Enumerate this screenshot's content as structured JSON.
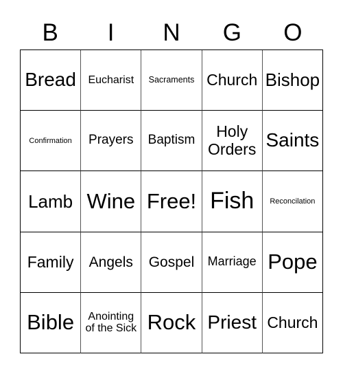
{
  "header": {
    "letters": [
      "B",
      "I",
      "N",
      "G",
      "O"
    ]
  },
  "cells": [
    [
      "Bread",
      "Eucharist",
      "Sacraments",
      "Church",
      "Bishop"
    ],
    [
      "Confirmation",
      "Prayers",
      "Baptism",
      "Holy Orders",
      "Saints"
    ],
    [
      "Lamb",
      "Wine",
      "Free!",
      "Fish",
      "Reconcilation"
    ],
    [
      "Family",
      "Angels",
      "Gospel",
      "Marriage",
      "Pope"
    ],
    [
      "Bible",
      "Anointing of the Sick",
      "Rock",
      "Priest",
      "Church"
    ]
  ]
}
